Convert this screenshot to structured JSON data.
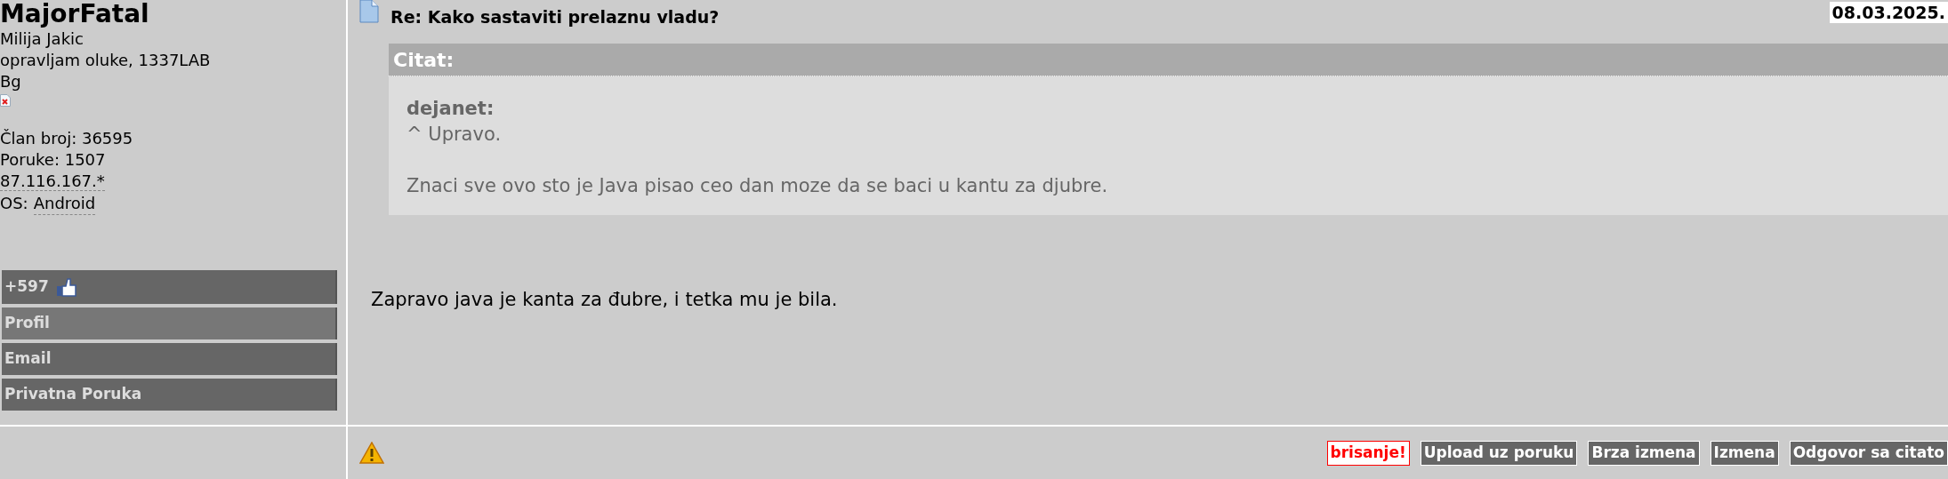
{
  "author": {
    "username": "MajorFatal",
    "lines": [
      "Milija Jakic",
      "opravljam oluke, 1337LAB",
      "Bg"
    ],
    "stats": [
      {
        "kind": "plain",
        "text": "Član broj: 36595"
      },
      {
        "kind": "plain",
        "text": "Poruke: 1507"
      },
      {
        "kind": "dotted",
        "text": "87.116.167.*"
      },
      {
        "kind": "os",
        "label": "OS:",
        "value": "Android"
      }
    ]
  },
  "author_menu": [
    {
      "kind": "rating",
      "label": "+597",
      "highlighted": false
    },
    {
      "kind": "link",
      "label": "Profil",
      "highlighted": true
    },
    {
      "kind": "link",
      "label": "Email",
      "highlighted": false
    },
    {
      "kind": "link",
      "label": "Privatna Poruka",
      "highlighted": false
    }
  ],
  "post": {
    "title": "Re: Kako sastaviti prelaznu vladu?",
    "date": "08.03.2025.",
    "quote": {
      "header": "Citat:",
      "author": "dejanet:",
      "paragraphs": [
        "^ Upravo.",
        "Znaci sve ovo sto je Java pisao ceo dan moze da se baci u kantu za djubre."
      ]
    },
    "body": "Zapravo java je kanta za đubre, i tetka mu je bila."
  },
  "actions": [
    {
      "kind": "danger",
      "label": "brisanje!"
    },
    {
      "kind": "normal",
      "label": "Upload uz poruku"
    },
    {
      "kind": "normal",
      "label": "Brza izmena"
    },
    {
      "kind": "normal",
      "label": "Izmena"
    },
    {
      "kind": "normal",
      "label": "Odgovor sa citato"
    }
  ]
}
